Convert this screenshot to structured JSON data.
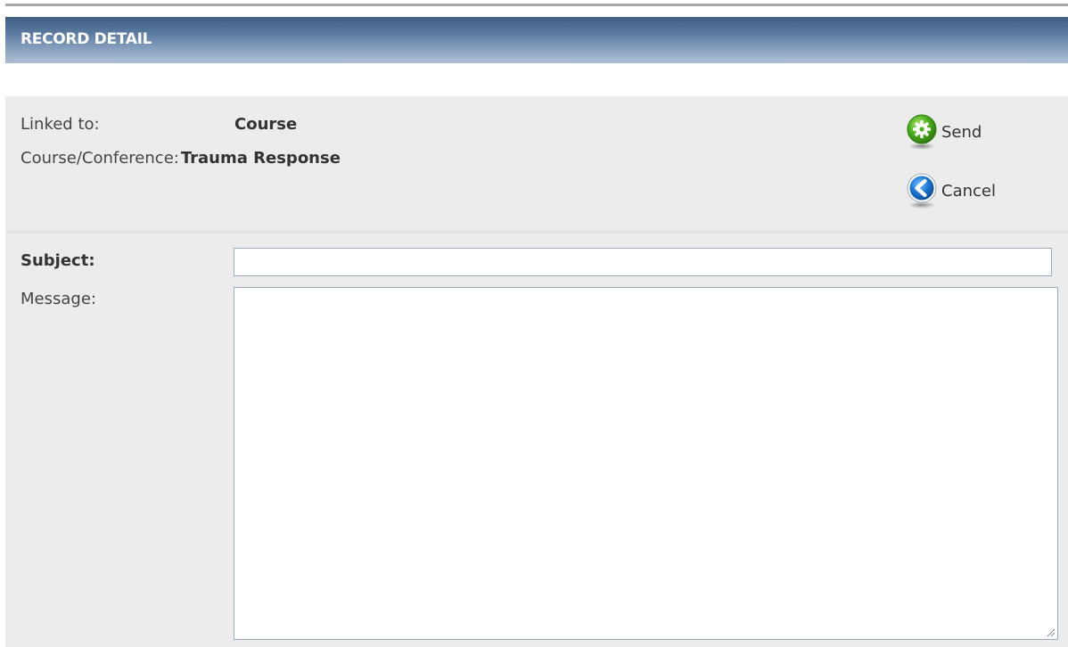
{
  "header": {
    "title": "RECORD DETAIL"
  },
  "info": {
    "linked_to_label": "Linked to:",
    "linked_to_value": "Course",
    "course_label": "Course/Conference:",
    "course_value": "Trauma Response"
  },
  "actions": {
    "send_label": "Send",
    "send_icon": "gear-icon",
    "cancel_label": "Cancel",
    "cancel_icon": "back-arrow-icon"
  },
  "form": {
    "subject_label": "Subject:",
    "subject_value": "",
    "message_label": "Message:",
    "message_value": ""
  },
  "colors": {
    "header_top": "#3f5f85",
    "header_bottom": "#aebfd4",
    "panel_bg": "#ececec",
    "send_icon_green": "#4caf1e",
    "cancel_icon_blue": "#1c78d4"
  }
}
